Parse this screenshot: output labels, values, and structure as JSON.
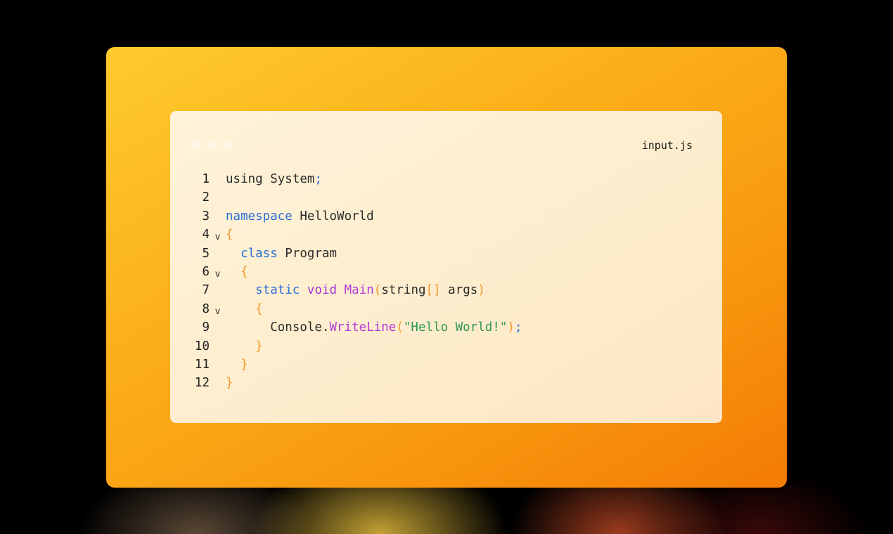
{
  "editor": {
    "filename": "input.js",
    "window_dots": 3,
    "lines": [
      {
        "number": "1",
        "foldable": false,
        "indent": "",
        "tokens": [
          {
            "t": "using System",
            "c": "plain"
          },
          {
            "t": ";",
            "c": "punct"
          }
        ]
      },
      {
        "number": "2",
        "foldable": false,
        "indent": "",
        "tokens": []
      },
      {
        "number": "3",
        "foldable": false,
        "indent": "",
        "tokens": [
          {
            "t": "namespace",
            "c": "kw-blue"
          },
          {
            "t": " HelloWorld",
            "c": "plain"
          }
        ]
      },
      {
        "number": "4",
        "foldable": true,
        "indent": "",
        "tokens": [
          {
            "t": "{",
            "c": "brace"
          }
        ]
      },
      {
        "number": "5",
        "foldable": false,
        "indent": "  ",
        "tokens": [
          {
            "t": "class",
            "c": "kw-blue"
          },
          {
            "t": " Program",
            "c": "plain"
          }
        ]
      },
      {
        "number": "6",
        "foldable": true,
        "indent": "  ",
        "tokens": [
          {
            "t": "{",
            "c": "brace"
          }
        ]
      },
      {
        "number": "7",
        "foldable": false,
        "indent": "    ",
        "tokens": [
          {
            "t": "static",
            "c": "kw-blue"
          },
          {
            "t": " ",
            "c": "plain"
          },
          {
            "t": "void",
            "c": "kw-purple"
          },
          {
            "t": " ",
            "c": "plain"
          },
          {
            "t": "Main",
            "c": "fn"
          },
          {
            "t": "(",
            "c": "brace"
          },
          {
            "t": "string",
            "c": "plain"
          },
          {
            "t": "[]",
            "c": "brace"
          },
          {
            "t": " args",
            "c": "plain"
          },
          {
            "t": ")",
            "c": "brace"
          }
        ]
      },
      {
        "number": "8",
        "foldable": true,
        "indent": "    ",
        "tokens": [
          {
            "t": "{",
            "c": "brace"
          }
        ]
      },
      {
        "number": "9",
        "foldable": false,
        "indent": "      ",
        "tokens": [
          {
            "t": "Console.",
            "c": "plain"
          },
          {
            "t": "WriteLine",
            "c": "fn"
          },
          {
            "t": "(",
            "c": "brace"
          },
          {
            "t": "\"Hello World!\"",
            "c": "str"
          },
          {
            "t": ")",
            "c": "brace"
          },
          {
            "t": ";",
            "c": "punct"
          }
        ]
      },
      {
        "number": "10",
        "foldable": false,
        "indent": "    ",
        "tokens": [
          {
            "t": "}",
            "c": "brace"
          }
        ]
      },
      {
        "number": "11",
        "foldable": false,
        "indent": "  ",
        "tokens": [
          {
            "t": "}",
            "c": "brace"
          }
        ]
      },
      {
        "number": "12",
        "foldable": false,
        "indent": "",
        "tokens": [
          {
            "t": "}",
            "c": "brace"
          }
        ]
      }
    ],
    "fold_icon": "chevron-down-icon"
  },
  "colors": {
    "frame_start": "#fecb2c",
    "frame_end": "#f47b05",
    "keyword": "#2b6fd6",
    "keyword_alt": "#a334d8",
    "function": "#b23ad9",
    "string": "#2f9a52",
    "brace": "#f39a2c"
  }
}
